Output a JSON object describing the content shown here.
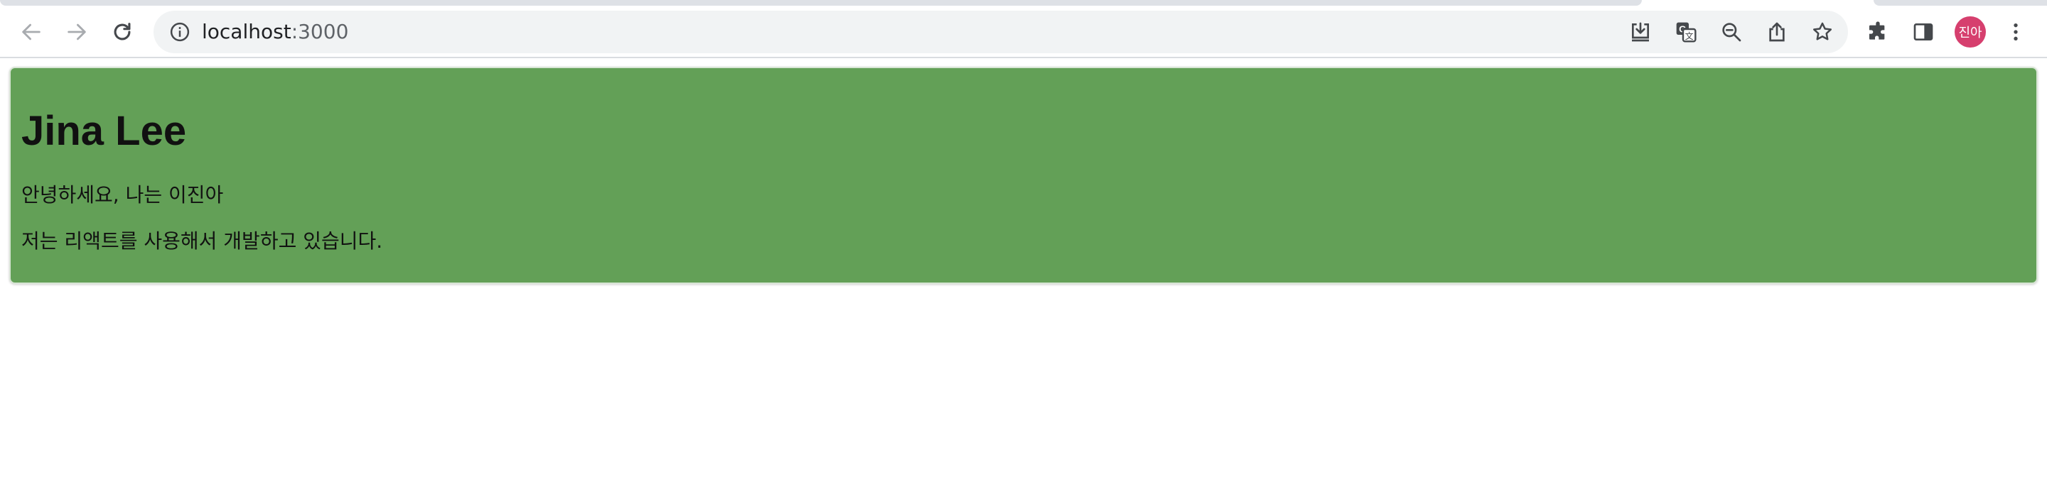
{
  "browser": {
    "url_host": "localhost",
    "url_port": ":3000",
    "profile_initials": "진아",
    "icons": {
      "back": "arrow-left-icon",
      "forward": "arrow-right-icon",
      "reload": "reload-icon",
      "site_info": "info-icon",
      "install": "install-app-icon",
      "translate": "translate-icon",
      "zoom": "zoom-out-icon",
      "share": "share-icon",
      "bookmark": "star-icon",
      "extensions": "puzzle-icon",
      "side_panel": "side-panel-icon",
      "menu": "kebab-menu-icon"
    },
    "colors": {
      "avatar": "#d63f6e"
    }
  },
  "card": {
    "name": "Jina Lee",
    "greeting": "안녕하세요, 나는 이진아",
    "intro": "저는 리액트를 사용해서 개발하고 있습니다.",
    "background": "#63a057"
  }
}
